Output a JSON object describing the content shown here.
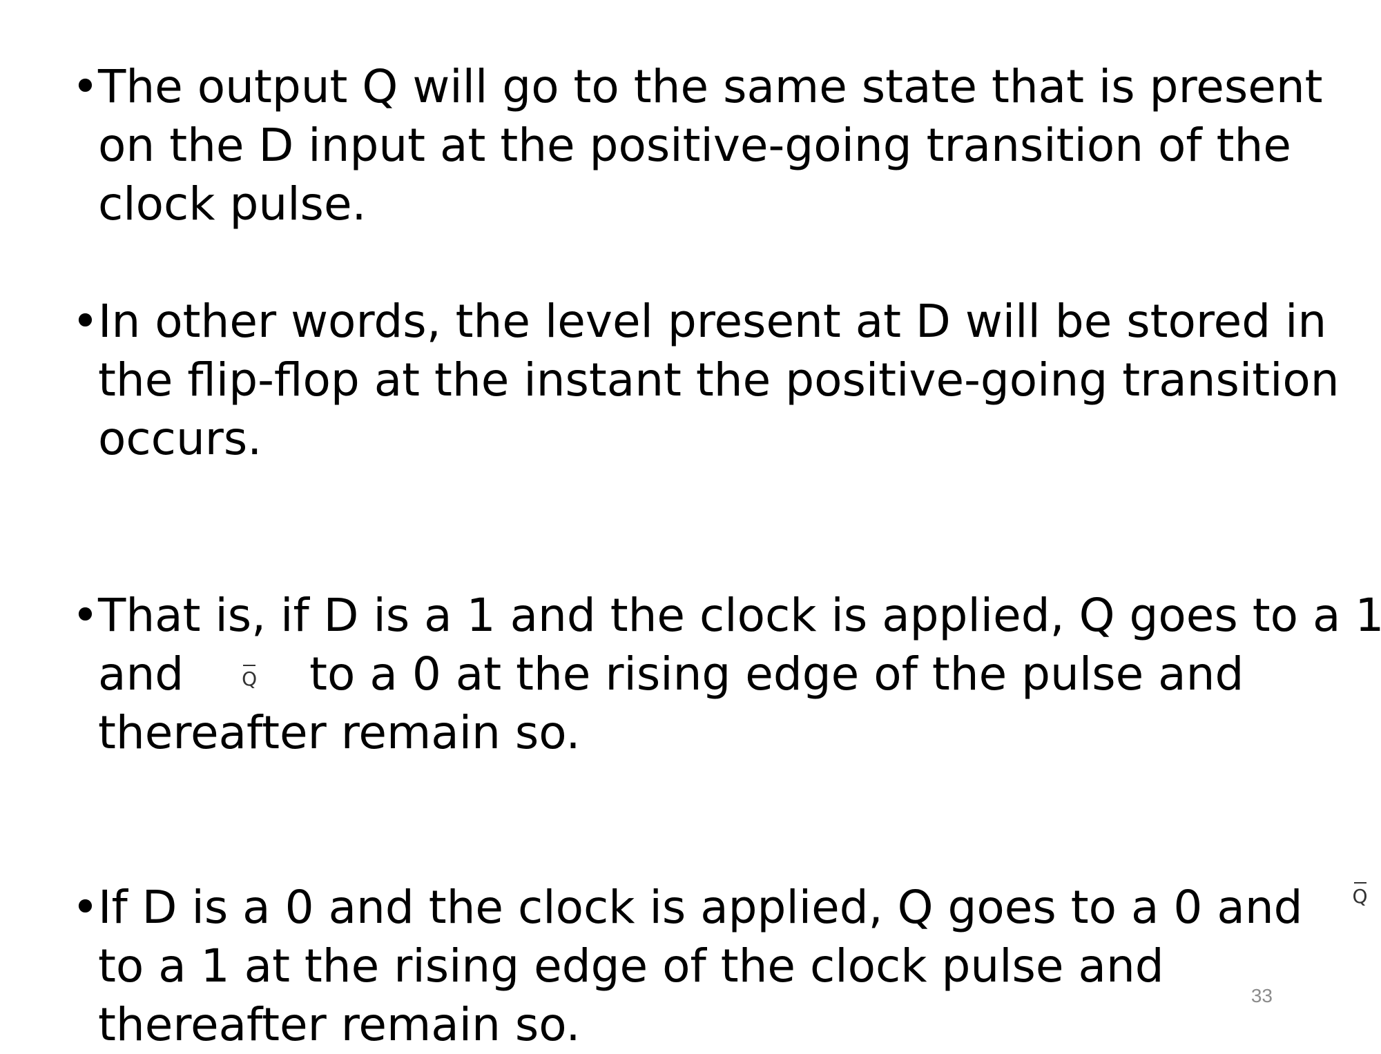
{
  "slide": {
    "bullets": [
      {
        "marker": "•",
        "lines": [
          "The output Q will go to the same state that is present",
          "on the D input at the positive-going transition of the",
          "clock pulse."
        ]
      },
      {
        "marker": "•",
        "lines": [
          "In other words, the level present at D will be stored in",
          "the flip-flop at the instant the positive-going transition",
          "occurs."
        ]
      },
      {
        "marker": "•",
        "lines": [
          "That is, if D is a 1 and the clock is applied, Q goes to a 1",
          {
            "before": "and",
            "symbol": "Q",
            "after": "to a 0 at the rising edge of the pulse and"
          },
          "thereafter remain so."
        ]
      },
      {
        "marker": "•",
        "lines": [
          {
            "before": "If D is a 0 and the clock is applied, Q goes to a 0 and",
            "symbol": "Q",
            "after": ""
          },
          "to a 1 at the rising edge of the clock pulse and",
          "thereafter remain so."
        ]
      }
    ],
    "page_number": "33"
  }
}
